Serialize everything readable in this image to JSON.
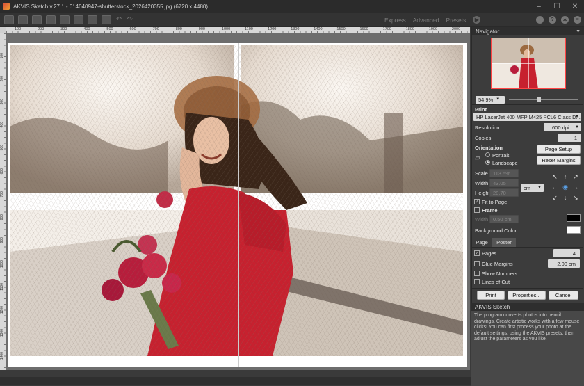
{
  "window": {
    "title": "AKVIS Sketch v.27.1 - 614040947-shutterstock_2026420355.jpg (6720 x 4480)",
    "controls": [
      "–",
      "☐",
      "✕"
    ]
  },
  "toolbar": {
    "modes": [
      "Express",
      "Advanced",
      "Presets"
    ]
  },
  "ruler": {
    "top_labels": [
      "100",
      "200",
      "300",
      "400",
      "500",
      "600",
      "700",
      "800",
      "900",
      "1000",
      "1100",
      "1200",
      "1300",
      "1400",
      "1500",
      "1600",
      "1700",
      "1800",
      "1900",
      "2000"
    ],
    "left_labels": [
      "100",
      "200",
      "300",
      "400",
      "500",
      "600",
      "700",
      "800",
      "900",
      "1000",
      "1100",
      "1200",
      "1300",
      "1400"
    ]
  },
  "navigator": {
    "header": "Navigator",
    "zoom": "54.9%"
  },
  "print": {
    "header": "Print",
    "printer": "HP LaserJet 400 MFP M425 PCL6 Class D...",
    "resolution_label": "Resolution",
    "resolution_value": "600 dpi",
    "copies_label": "Copies",
    "copies_value": "1",
    "orientation_label": "Orientation",
    "portrait_label": "Portrait",
    "landscape_label": "Landscape",
    "page_setup_button": "Page Setup",
    "reset_margins_button": "Reset Margins",
    "scale_label": "Scale",
    "scale_value": "113.5%",
    "width_label": "Width",
    "width_value": "43.05",
    "height_label": "Height",
    "height_value": "28.70",
    "unit_value": "cm",
    "fit_to_page_label": "Fit to Page",
    "frame_label": "Frame",
    "frame_width_label": "Width",
    "frame_width_value": "0.50 cm",
    "frame_color": "#000000",
    "background_color_label": "Background Color",
    "background_color": "#ffffff"
  },
  "tabs": {
    "page": "Page",
    "poster": "Poster"
  },
  "poster": {
    "pages_label": "Pages",
    "pages_value": "4",
    "glue_margins_label": "Glue Margins",
    "glue_margins_value": "2,00 cm",
    "show_numbers_label": "Show Numbers",
    "lines_of_cut_label": "Lines of Cut"
  },
  "actions": {
    "print_button": "Print",
    "properties_button": "Properties...",
    "cancel_button": "Cancel"
  },
  "about": {
    "title": "AKVIS Sketch",
    "text": "The program converts photos into pencil drawings. Create artistic works with a few mouse clicks! You can first process your photo at the default settings, using the AKVIS presets, then adjust the parameters as you like."
  }
}
